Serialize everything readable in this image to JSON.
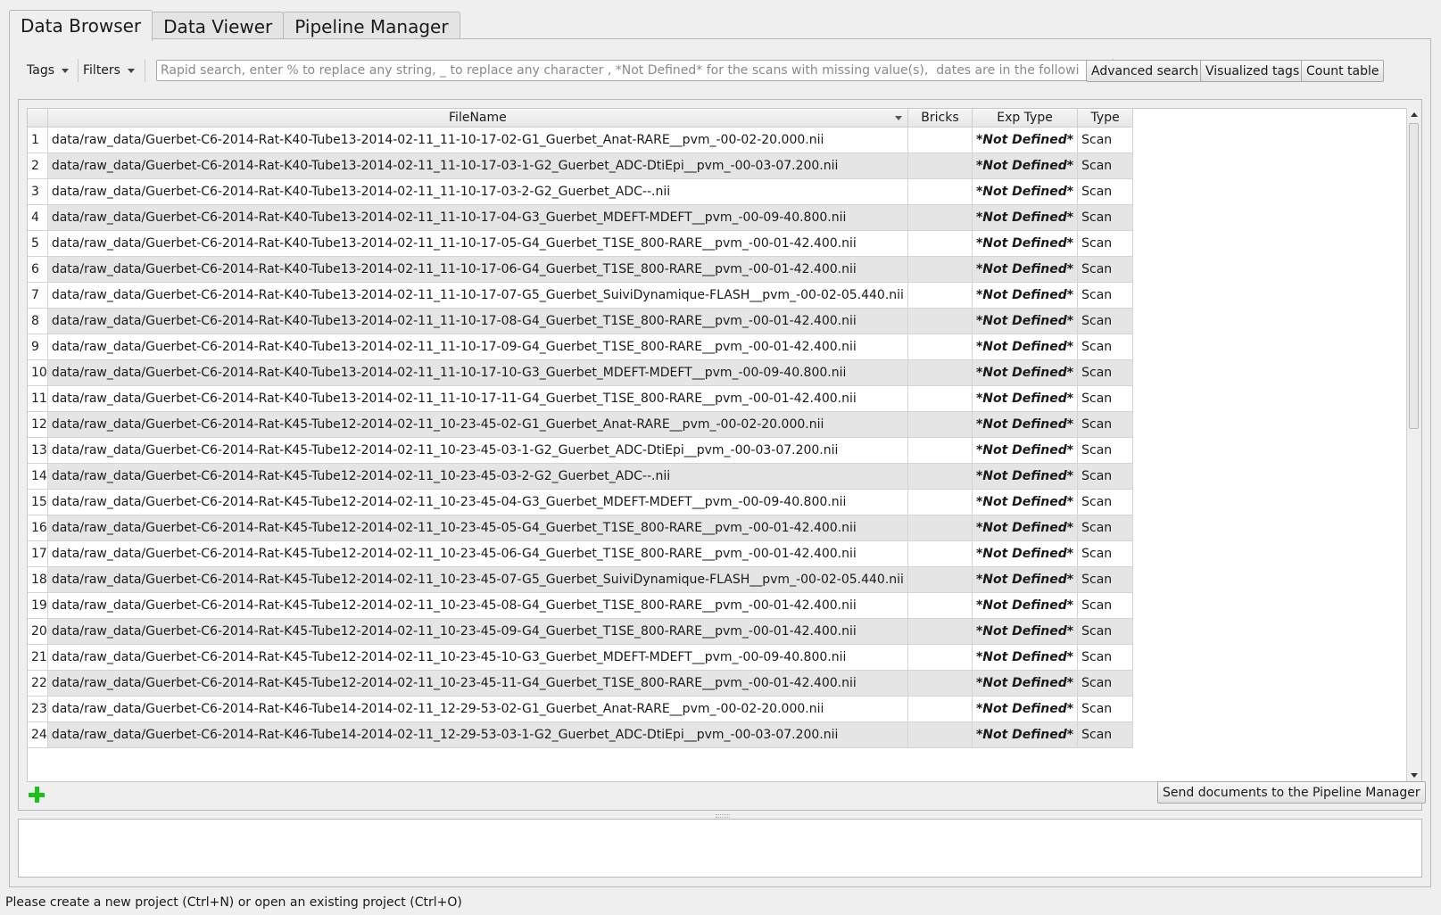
{
  "tabs": [
    {
      "label": "Data Browser",
      "active": true
    },
    {
      "label": "Data Viewer",
      "active": false
    },
    {
      "label": "Pipeline Manager",
      "active": false
    }
  ],
  "toolbar": {
    "tags_label": "Tags",
    "filters_label": "Filters",
    "search_placeholder": "Rapid search, enter % to replace any string, _ to replace any character , *Not Defined* for the scans with missing value(s),  dates are in the following fo...",
    "advanced_search_label": "Advanced search",
    "visualized_tags_label": "Visualized tags",
    "count_table_label": "Count table"
  },
  "table": {
    "columns": [
      "FileName",
      "Bricks",
      "Exp Type",
      "Type"
    ],
    "rows": [
      {
        "num": "1",
        "filename": "data/raw_data/Guerbet-C6-2014-Rat-K40-Tube13-2014-02-11_11-10-17-02-G1_Guerbet_Anat-RARE__pvm_-00-02-20.000.nii",
        "bricks": "",
        "exp_type": "*Not Defined*",
        "type": "Scan"
      },
      {
        "num": "2",
        "filename": "data/raw_data/Guerbet-C6-2014-Rat-K40-Tube13-2014-02-11_11-10-17-03-1-G2_Guerbet_ADC-DtiEpi__pvm_-00-03-07.200.nii",
        "bricks": "",
        "exp_type": "*Not Defined*",
        "type": "Scan"
      },
      {
        "num": "3",
        "filename": "data/raw_data/Guerbet-C6-2014-Rat-K40-Tube13-2014-02-11_11-10-17-03-2-G2_Guerbet_ADC--.nii",
        "bricks": "",
        "exp_type": "*Not Defined*",
        "type": "Scan"
      },
      {
        "num": "4",
        "filename": "data/raw_data/Guerbet-C6-2014-Rat-K40-Tube13-2014-02-11_11-10-17-04-G3_Guerbet_MDEFT-MDEFT__pvm_-00-09-40.800.nii",
        "bricks": "",
        "exp_type": "*Not Defined*",
        "type": "Scan"
      },
      {
        "num": "5",
        "filename": "data/raw_data/Guerbet-C6-2014-Rat-K40-Tube13-2014-02-11_11-10-17-05-G4_Guerbet_T1SE_800-RARE__pvm_-00-01-42.400.nii",
        "bricks": "",
        "exp_type": "*Not Defined*",
        "type": "Scan"
      },
      {
        "num": "6",
        "filename": "data/raw_data/Guerbet-C6-2014-Rat-K40-Tube13-2014-02-11_11-10-17-06-G4_Guerbet_T1SE_800-RARE__pvm_-00-01-42.400.nii",
        "bricks": "",
        "exp_type": "*Not Defined*",
        "type": "Scan"
      },
      {
        "num": "7",
        "filename": "data/raw_data/Guerbet-C6-2014-Rat-K40-Tube13-2014-02-11_11-10-17-07-G5_Guerbet_SuiviDynamique-FLASH__pvm_-00-02-05.440.nii",
        "bricks": "",
        "exp_type": "*Not Defined*",
        "type": "Scan"
      },
      {
        "num": "8",
        "filename": "data/raw_data/Guerbet-C6-2014-Rat-K40-Tube13-2014-02-11_11-10-17-08-G4_Guerbet_T1SE_800-RARE__pvm_-00-01-42.400.nii",
        "bricks": "",
        "exp_type": "*Not Defined*",
        "type": "Scan"
      },
      {
        "num": "9",
        "filename": "data/raw_data/Guerbet-C6-2014-Rat-K40-Tube13-2014-02-11_11-10-17-09-G4_Guerbet_T1SE_800-RARE__pvm_-00-01-42.400.nii",
        "bricks": "",
        "exp_type": "*Not Defined*",
        "type": "Scan"
      },
      {
        "num": "10",
        "filename": "data/raw_data/Guerbet-C6-2014-Rat-K40-Tube13-2014-02-11_11-10-17-10-G3_Guerbet_MDEFT-MDEFT__pvm_-00-09-40.800.nii",
        "bricks": "",
        "exp_type": "*Not Defined*",
        "type": "Scan"
      },
      {
        "num": "11",
        "filename": "data/raw_data/Guerbet-C6-2014-Rat-K40-Tube13-2014-02-11_11-10-17-11-G4_Guerbet_T1SE_800-RARE__pvm_-00-01-42.400.nii",
        "bricks": "",
        "exp_type": "*Not Defined*",
        "type": "Scan"
      },
      {
        "num": "12",
        "filename": "data/raw_data/Guerbet-C6-2014-Rat-K45-Tube12-2014-02-11_10-23-45-02-G1_Guerbet_Anat-RARE__pvm_-00-02-20.000.nii",
        "bricks": "",
        "exp_type": "*Not Defined*",
        "type": "Scan"
      },
      {
        "num": "13",
        "filename": "data/raw_data/Guerbet-C6-2014-Rat-K45-Tube12-2014-02-11_10-23-45-03-1-G2_Guerbet_ADC-DtiEpi__pvm_-00-03-07.200.nii",
        "bricks": "",
        "exp_type": "*Not Defined*",
        "type": "Scan"
      },
      {
        "num": "14",
        "filename": "data/raw_data/Guerbet-C6-2014-Rat-K45-Tube12-2014-02-11_10-23-45-03-2-G2_Guerbet_ADC--.nii",
        "bricks": "",
        "exp_type": "*Not Defined*",
        "type": "Scan"
      },
      {
        "num": "15",
        "filename": "data/raw_data/Guerbet-C6-2014-Rat-K45-Tube12-2014-02-11_10-23-45-04-G3_Guerbet_MDEFT-MDEFT__pvm_-00-09-40.800.nii",
        "bricks": "",
        "exp_type": "*Not Defined*",
        "type": "Scan"
      },
      {
        "num": "16",
        "filename": "data/raw_data/Guerbet-C6-2014-Rat-K45-Tube12-2014-02-11_10-23-45-05-G4_Guerbet_T1SE_800-RARE__pvm_-00-01-42.400.nii",
        "bricks": "",
        "exp_type": "*Not Defined*",
        "type": "Scan"
      },
      {
        "num": "17",
        "filename": "data/raw_data/Guerbet-C6-2014-Rat-K45-Tube12-2014-02-11_10-23-45-06-G4_Guerbet_T1SE_800-RARE__pvm_-00-01-42.400.nii",
        "bricks": "",
        "exp_type": "*Not Defined*",
        "type": "Scan"
      },
      {
        "num": "18",
        "filename": "data/raw_data/Guerbet-C6-2014-Rat-K45-Tube12-2014-02-11_10-23-45-07-G5_Guerbet_SuiviDynamique-FLASH__pvm_-00-02-05.440.nii",
        "bricks": "",
        "exp_type": "*Not Defined*",
        "type": "Scan"
      },
      {
        "num": "19",
        "filename": "data/raw_data/Guerbet-C6-2014-Rat-K45-Tube12-2014-02-11_10-23-45-08-G4_Guerbet_T1SE_800-RARE__pvm_-00-01-42.400.nii",
        "bricks": "",
        "exp_type": "*Not Defined*",
        "type": "Scan"
      },
      {
        "num": "20",
        "filename": "data/raw_data/Guerbet-C6-2014-Rat-K45-Tube12-2014-02-11_10-23-45-09-G4_Guerbet_T1SE_800-RARE__pvm_-00-01-42.400.nii",
        "bricks": "",
        "exp_type": "*Not Defined*",
        "type": "Scan"
      },
      {
        "num": "21",
        "filename": "data/raw_data/Guerbet-C6-2014-Rat-K45-Tube12-2014-02-11_10-23-45-10-G3_Guerbet_MDEFT-MDEFT__pvm_-00-09-40.800.nii",
        "bricks": "",
        "exp_type": "*Not Defined*",
        "type": "Scan"
      },
      {
        "num": "22",
        "filename": "data/raw_data/Guerbet-C6-2014-Rat-K45-Tube12-2014-02-11_10-23-45-11-G4_Guerbet_T1SE_800-RARE__pvm_-00-01-42.400.nii",
        "bricks": "",
        "exp_type": "*Not Defined*",
        "type": "Scan"
      },
      {
        "num": "23",
        "filename": "data/raw_data/Guerbet-C6-2014-Rat-K46-Tube14-2014-02-11_12-29-53-02-G1_Guerbet_Anat-RARE__pvm_-00-02-20.000.nii",
        "bricks": "",
        "exp_type": "*Not Defined*",
        "type": "Scan"
      },
      {
        "num": "24",
        "filename": "data/raw_data/Guerbet-C6-2014-Rat-K46-Tube14-2014-02-11_12-29-53-03-1-G2_Guerbet_ADC-DtiEpi__pvm_-00-03-07.200.nii",
        "bricks": "",
        "exp_type": "*Not Defined*",
        "type": "Scan"
      }
    ]
  },
  "actions": {
    "add_icon": "plus-icon",
    "send_label": "Send documents to the Pipeline Manager"
  },
  "status": {
    "message": "Please create a new project (Ctrl+N) or open an existing project (Ctrl+O)"
  },
  "colors": {
    "add_icon": "#19c319",
    "alt_row": "#e5e5e5"
  }
}
